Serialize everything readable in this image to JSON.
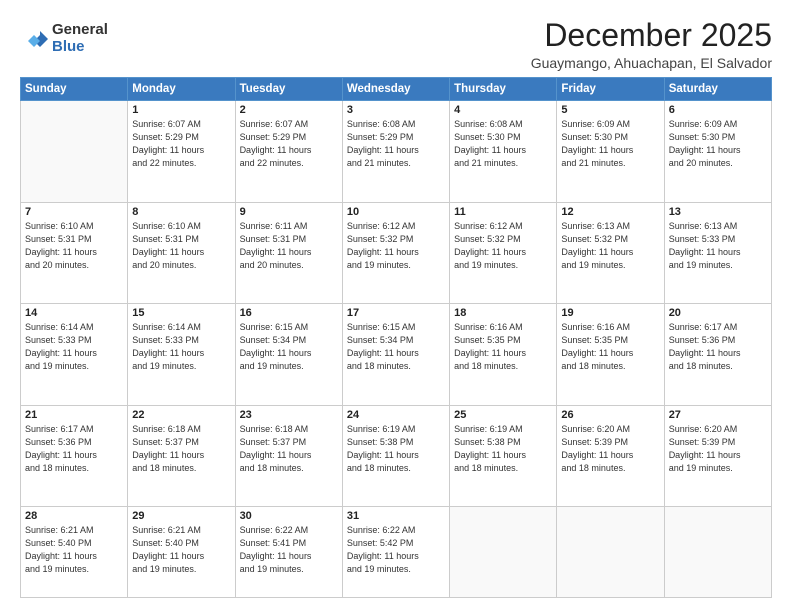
{
  "logo": {
    "general": "General",
    "blue": "Blue"
  },
  "header": {
    "month": "December 2025",
    "location": "Guaymango, Ahuachapan, El Salvador"
  },
  "weekdays": [
    "Sunday",
    "Monday",
    "Tuesday",
    "Wednesday",
    "Thursday",
    "Friday",
    "Saturday"
  ],
  "weeks": [
    [
      {
        "day": "",
        "info": ""
      },
      {
        "day": "1",
        "info": "Sunrise: 6:07 AM\nSunset: 5:29 PM\nDaylight: 11 hours\nand 22 minutes."
      },
      {
        "day": "2",
        "info": "Sunrise: 6:07 AM\nSunset: 5:29 PM\nDaylight: 11 hours\nand 22 minutes."
      },
      {
        "day": "3",
        "info": "Sunrise: 6:08 AM\nSunset: 5:29 PM\nDaylight: 11 hours\nand 21 minutes."
      },
      {
        "day": "4",
        "info": "Sunrise: 6:08 AM\nSunset: 5:30 PM\nDaylight: 11 hours\nand 21 minutes."
      },
      {
        "day": "5",
        "info": "Sunrise: 6:09 AM\nSunset: 5:30 PM\nDaylight: 11 hours\nand 21 minutes."
      },
      {
        "day": "6",
        "info": "Sunrise: 6:09 AM\nSunset: 5:30 PM\nDaylight: 11 hours\nand 20 minutes."
      }
    ],
    [
      {
        "day": "7",
        "info": "Sunrise: 6:10 AM\nSunset: 5:31 PM\nDaylight: 11 hours\nand 20 minutes."
      },
      {
        "day": "8",
        "info": "Sunrise: 6:10 AM\nSunset: 5:31 PM\nDaylight: 11 hours\nand 20 minutes."
      },
      {
        "day": "9",
        "info": "Sunrise: 6:11 AM\nSunset: 5:31 PM\nDaylight: 11 hours\nand 20 minutes."
      },
      {
        "day": "10",
        "info": "Sunrise: 6:12 AM\nSunset: 5:32 PM\nDaylight: 11 hours\nand 19 minutes."
      },
      {
        "day": "11",
        "info": "Sunrise: 6:12 AM\nSunset: 5:32 PM\nDaylight: 11 hours\nand 19 minutes."
      },
      {
        "day": "12",
        "info": "Sunrise: 6:13 AM\nSunset: 5:32 PM\nDaylight: 11 hours\nand 19 minutes."
      },
      {
        "day": "13",
        "info": "Sunrise: 6:13 AM\nSunset: 5:33 PM\nDaylight: 11 hours\nand 19 minutes."
      }
    ],
    [
      {
        "day": "14",
        "info": "Sunrise: 6:14 AM\nSunset: 5:33 PM\nDaylight: 11 hours\nand 19 minutes."
      },
      {
        "day": "15",
        "info": "Sunrise: 6:14 AM\nSunset: 5:33 PM\nDaylight: 11 hours\nand 19 minutes."
      },
      {
        "day": "16",
        "info": "Sunrise: 6:15 AM\nSunset: 5:34 PM\nDaylight: 11 hours\nand 19 minutes."
      },
      {
        "day": "17",
        "info": "Sunrise: 6:15 AM\nSunset: 5:34 PM\nDaylight: 11 hours\nand 18 minutes."
      },
      {
        "day": "18",
        "info": "Sunrise: 6:16 AM\nSunset: 5:35 PM\nDaylight: 11 hours\nand 18 minutes."
      },
      {
        "day": "19",
        "info": "Sunrise: 6:16 AM\nSunset: 5:35 PM\nDaylight: 11 hours\nand 18 minutes."
      },
      {
        "day": "20",
        "info": "Sunrise: 6:17 AM\nSunset: 5:36 PM\nDaylight: 11 hours\nand 18 minutes."
      }
    ],
    [
      {
        "day": "21",
        "info": "Sunrise: 6:17 AM\nSunset: 5:36 PM\nDaylight: 11 hours\nand 18 minutes."
      },
      {
        "day": "22",
        "info": "Sunrise: 6:18 AM\nSunset: 5:37 PM\nDaylight: 11 hours\nand 18 minutes."
      },
      {
        "day": "23",
        "info": "Sunrise: 6:18 AM\nSunset: 5:37 PM\nDaylight: 11 hours\nand 18 minutes."
      },
      {
        "day": "24",
        "info": "Sunrise: 6:19 AM\nSunset: 5:38 PM\nDaylight: 11 hours\nand 18 minutes."
      },
      {
        "day": "25",
        "info": "Sunrise: 6:19 AM\nSunset: 5:38 PM\nDaylight: 11 hours\nand 18 minutes."
      },
      {
        "day": "26",
        "info": "Sunrise: 6:20 AM\nSunset: 5:39 PM\nDaylight: 11 hours\nand 18 minutes."
      },
      {
        "day": "27",
        "info": "Sunrise: 6:20 AM\nSunset: 5:39 PM\nDaylight: 11 hours\nand 19 minutes."
      }
    ],
    [
      {
        "day": "28",
        "info": "Sunrise: 6:21 AM\nSunset: 5:40 PM\nDaylight: 11 hours\nand 19 minutes."
      },
      {
        "day": "29",
        "info": "Sunrise: 6:21 AM\nSunset: 5:40 PM\nDaylight: 11 hours\nand 19 minutes."
      },
      {
        "day": "30",
        "info": "Sunrise: 6:22 AM\nSunset: 5:41 PM\nDaylight: 11 hours\nand 19 minutes."
      },
      {
        "day": "31",
        "info": "Sunrise: 6:22 AM\nSunset: 5:42 PM\nDaylight: 11 hours\nand 19 minutes."
      },
      {
        "day": "",
        "info": ""
      },
      {
        "day": "",
        "info": ""
      },
      {
        "day": "",
        "info": ""
      }
    ]
  ]
}
